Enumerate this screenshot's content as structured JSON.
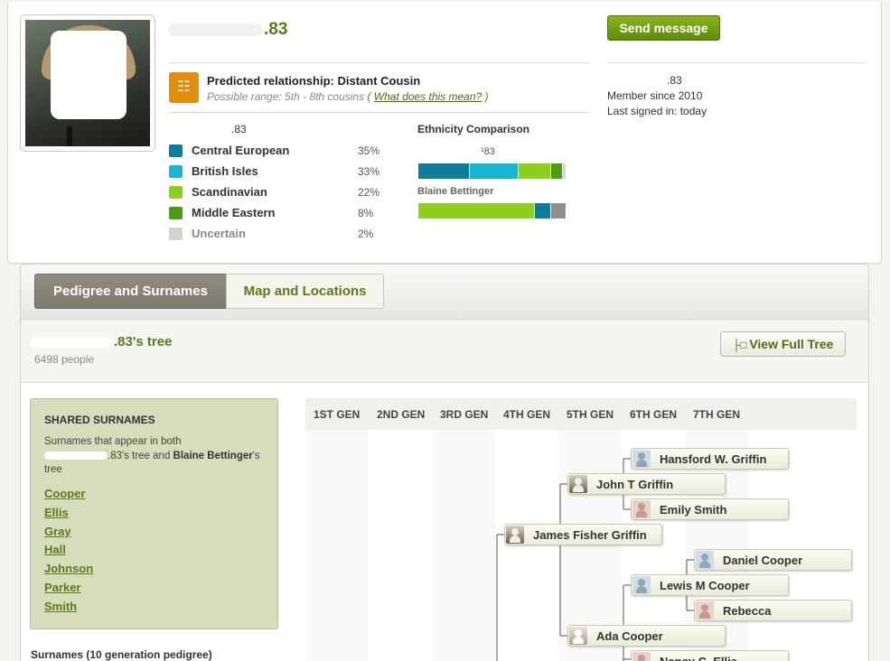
{
  "profile": {
    "username_visible": ".83",
    "send_button": "Send message",
    "meta_username": ".83",
    "member_since": "Member since 2010",
    "last_signed_in": "Last signed in: today"
  },
  "relationship": {
    "title": "Predicted relationship: Distant Cousin",
    "range": "Possible range: 5th - 8th cousins",
    "paren_open": "(",
    "link": "What does this mean?",
    "paren_close": ")"
  },
  "ethnicity": {
    "user_label": ".83",
    "rows": [
      {
        "name": "Central European",
        "pct": "35%",
        "color": "#0f7d95"
      },
      {
        "name": "British Isles",
        "pct": "33%",
        "color": "#18b6d2"
      },
      {
        "name": "Scandinavian",
        "pct": "22%",
        "color": "#8ccf1d"
      },
      {
        "name": "Middle Eastern",
        "pct": "8%",
        "color": "#4a9d12"
      },
      {
        "name": "Uncertain",
        "pct": "2%",
        "color": "#d2d2d2"
      }
    ],
    "comparison_title": "Ethnicity Comparison",
    "comparison_user": "¹83",
    "comparison_other": "Blaine Bettinger",
    "bar_user": [
      35,
      33,
      22,
      8,
      2
    ],
    "bar_other": [
      {
        "share": 79,
        "color": "#8ccf1d"
      },
      {
        "share": 11,
        "color": "#0f7d95"
      },
      {
        "share": 10,
        "color": "#8f8f8f"
      }
    ]
  },
  "tabs": {
    "pedigree": "Pedigree and Surnames",
    "map": "Map and Locations"
  },
  "tree": {
    "title_suffix": ".83's tree",
    "count": "6498 people",
    "view_full": "View Full Tree"
  },
  "shared": {
    "title": "SHARED SURNAMES",
    "desc_line1": "Surnames that appear in both",
    "desc_user_suffix": ".83",
    "desc_mid": "'s tree and ",
    "desc_bold": "Blaine Bettinger",
    "desc_end": "'s tree",
    "surnames": [
      "Cooper",
      "Ellis",
      "Gray",
      "Hall",
      "Johnson",
      "Parker",
      "Smith"
    ],
    "footer": "Surnames (10 generation pedigree)"
  },
  "generations": [
    "1ST GEN",
    "2ND GEN",
    "3RD GEN",
    "4TH GEN",
    "5TH GEN",
    "6TH GEN",
    "7TH GEN"
  ],
  "people": [
    {
      "name": "Hansford W. Griffin",
      "avatar": "m"
    },
    {
      "name": "John T Griffin",
      "avatar": "ph"
    },
    {
      "name": "Emily Smith",
      "avatar": "f"
    },
    {
      "name": "James Fisher Griffin",
      "avatar": "ph"
    },
    {
      "name": "Daniel Cooper",
      "avatar": "m"
    },
    {
      "name": "Lewis M Cooper",
      "avatar": "m"
    },
    {
      "name": "Rebecca",
      "avatar": "f"
    },
    {
      "name": "Ada Cooper",
      "avatar": "ph2"
    },
    {
      "name": "Nancy C. Ellis",
      "avatar": "f"
    }
  ]
}
